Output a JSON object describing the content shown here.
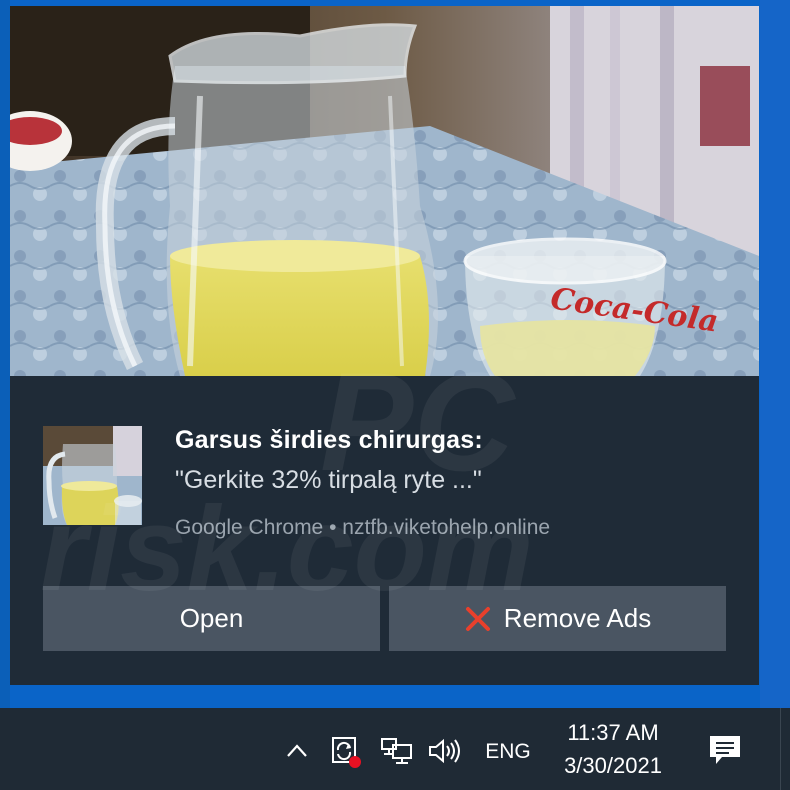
{
  "toast": {
    "title": "Garsus širdies chirurgas:",
    "message": "\"Gerkite 32% tirpalą ryte ...\"",
    "attribution": "Google Chrome • nztfb.viketohelp.online",
    "buttons": {
      "open_label": "Open",
      "remove_label": "Remove Ads"
    },
    "hero_image": "glass-pitcher-with-yellow-liquid-and-coca-cola-glass-photo",
    "thumbnail_image": "glass-pitcher-thumbnail"
  },
  "taskbar": {
    "icons": [
      "chevron-up-icon",
      "sync-alert-icon",
      "network-icon",
      "volume-icon",
      "action-center-icon"
    ],
    "language": "ENG",
    "time": "11:37 AM",
    "date": "3/30/2021"
  },
  "colors": {
    "desktop": "#0a64c8",
    "toast_bg": "#1f2b37",
    "button_bg": "#4a5562",
    "remove_x": "#e8402c",
    "sync_dot": "#e81123"
  },
  "watermark": "PC risk.com"
}
